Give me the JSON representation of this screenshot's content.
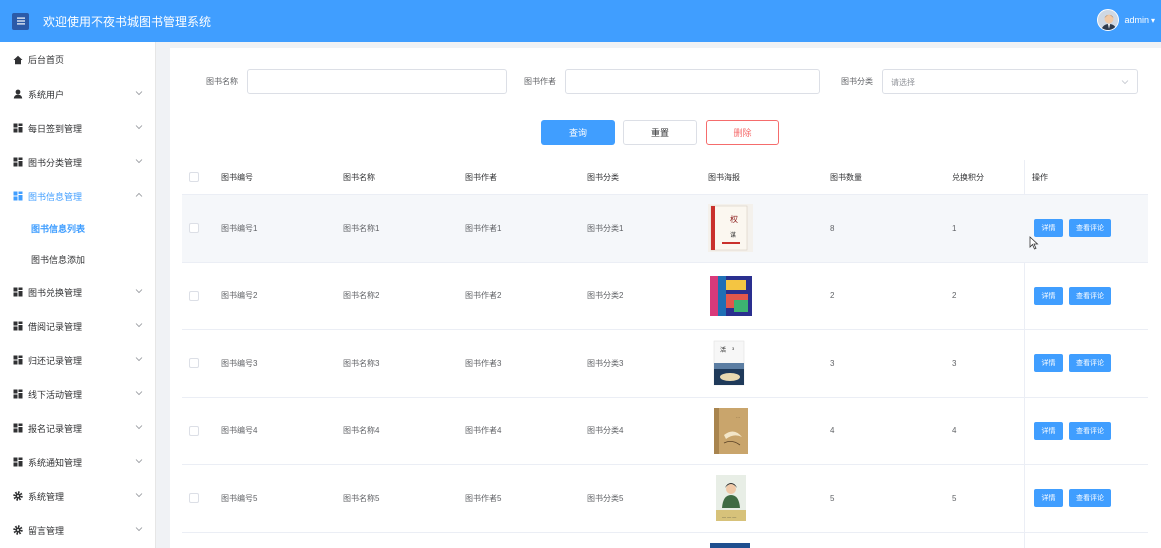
{
  "header": {
    "title": "欢迎使用不夜书城图书管理系统",
    "user": "admin",
    "colors": {
      "primary": "#409eff",
      "danger": "#f56c6c"
    }
  },
  "sidebar": {
    "items": [
      {
        "label": "后台首页",
        "icon": "home-icon",
        "expandable": false
      },
      {
        "label": "系统用户",
        "icon": "user-icon",
        "expandable": true
      },
      {
        "label": "每日签到管理",
        "icon": "grid-icon",
        "expandable": true
      },
      {
        "label": "图书分类管理",
        "icon": "grid-icon",
        "expandable": true
      },
      {
        "label": "图书信息管理",
        "icon": "grid-icon",
        "expandable": true,
        "expanded": true,
        "active": true
      },
      {
        "label": "图书兑换管理",
        "icon": "grid-icon",
        "expandable": true
      },
      {
        "label": "借阅记录管理",
        "icon": "grid-icon",
        "expandable": true
      },
      {
        "label": "归还记录管理",
        "icon": "grid-icon",
        "expandable": true
      },
      {
        "label": "线下活动管理",
        "icon": "grid-icon",
        "expandable": true
      },
      {
        "label": "报名记录管理",
        "icon": "grid-icon",
        "expandable": true
      },
      {
        "label": "系统通知管理",
        "icon": "grid-icon",
        "expandable": true
      },
      {
        "label": "系统管理",
        "icon": "gear-icon",
        "expandable": true
      },
      {
        "label": "留言管理",
        "icon": "gear-icon",
        "expandable": true
      }
    ],
    "submenu": [
      {
        "label": "图书信息列表",
        "current": true
      },
      {
        "label": "图书信息添加",
        "current": false
      }
    ]
  },
  "search": {
    "name_label": "图书名称",
    "name_value": "",
    "author_label": "图书作者",
    "author_value": "",
    "category_label": "图书分类",
    "category_placeholder": "请选择"
  },
  "buttons": {
    "query": "查询",
    "reset": "重置",
    "delete": "删除"
  },
  "table": {
    "headers": [
      "图书编号",
      "图书名称",
      "图书作者",
      "图书分类",
      "图书海报",
      "图书数量",
      "兑换积分",
      "操作"
    ],
    "rows": [
      {
        "code": "图书编号1",
        "name": "图书名称1",
        "author": "图书作者1",
        "category": "图书分类1",
        "poster": "book-cover-1",
        "quantity": "8",
        "points": "1"
      },
      {
        "code": "图书编号2",
        "name": "图书名称2",
        "author": "图书作者2",
        "category": "图书分类2",
        "poster": "book-cover-2",
        "quantity": "2",
        "points": "2"
      },
      {
        "code": "图书编号3",
        "name": "图书名称3",
        "author": "图书作者3",
        "category": "图书分类3",
        "poster": "book-cover-3",
        "quantity": "3",
        "points": "3"
      },
      {
        "code": "图书编号4",
        "name": "图书名称4",
        "author": "图书作者4",
        "category": "图书分类4",
        "poster": "book-cover-4",
        "quantity": "4",
        "points": "4"
      },
      {
        "code": "图书编号5",
        "name": "图书名称5",
        "author": "图书作者5",
        "category": "图书分类5",
        "poster": "book-cover-5",
        "quantity": "5",
        "points": "5"
      }
    ],
    "actions": {
      "detail": "详情",
      "comments": "查看评论"
    }
  }
}
